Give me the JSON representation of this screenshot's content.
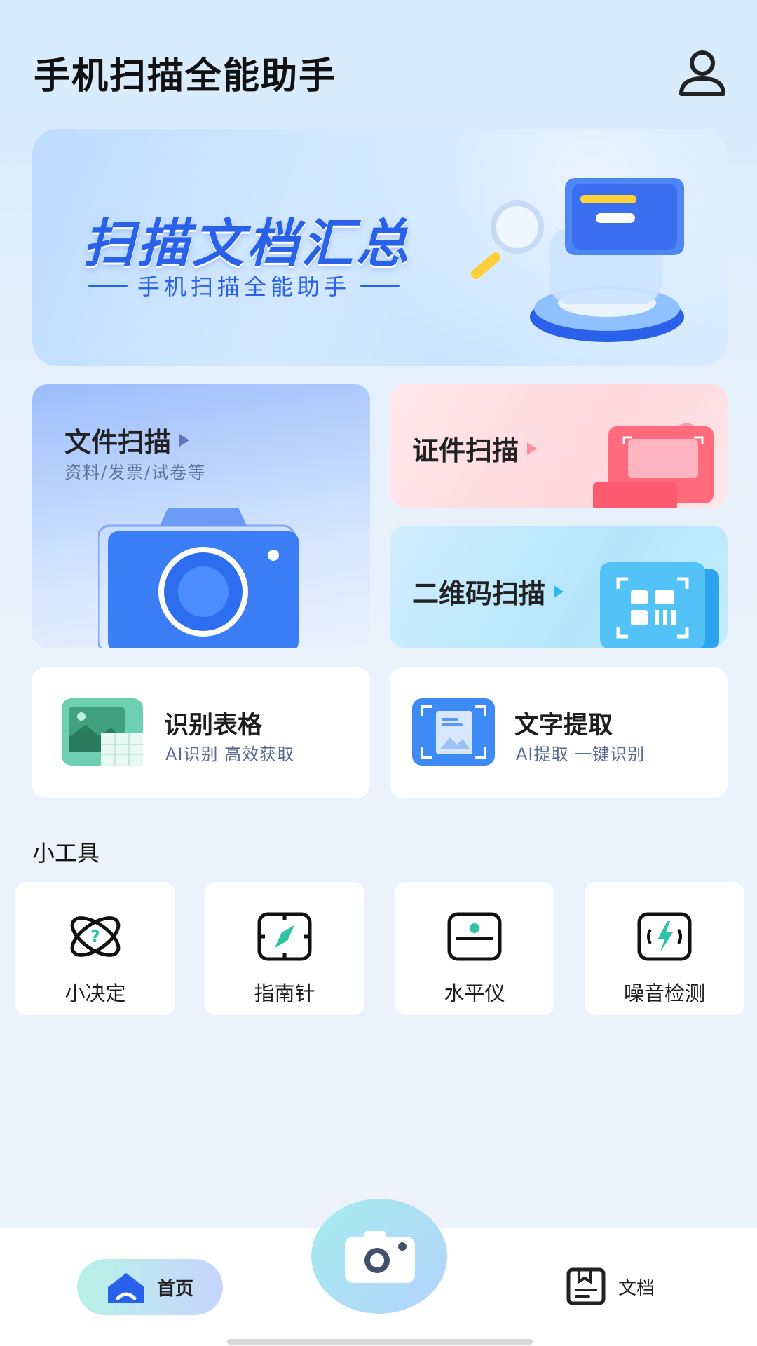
{
  "header": {
    "title": "手机扫描全能助手",
    "profile_icon": "user-icon"
  },
  "banner": {
    "title": "扫描文档汇总",
    "subtitle": "手机扫描全能助手"
  },
  "features": {
    "file_scan": {
      "label": "文件扫描",
      "sub": "资料/发票/试卷等",
      "icon": "camera-icon"
    },
    "id_scan": {
      "label": "证件扫描",
      "icon": "id-card-icon"
    },
    "qr_scan": {
      "label": "二维码扫描",
      "icon": "qr-code-icon"
    }
  },
  "recognition": {
    "table": {
      "title": "识别表格",
      "sub": "AI识别 高效获取",
      "icon": "table-image-icon"
    },
    "text": {
      "title": "文字提取",
      "sub": "AI提取 一键识别",
      "icon": "document-scan-icon"
    }
  },
  "tools": {
    "section_title": "小工具",
    "items": [
      {
        "label": "小决定",
        "icon": "decision-icon"
      },
      {
        "label": "指南针",
        "icon": "compass-icon"
      },
      {
        "label": "水平仪",
        "icon": "level-icon"
      },
      {
        "label": "噪音检测",
        "icon": "noise-icon"
      }
    ]
  },
  "bottom_nav": {
    "home_label": "首页",
    "docs_label": "文档",
    "camera_icon": "camera-icon"
  },
  "colors": {
    "accent_blue": "#2a61ea",
    "teal": "#2fc4a4"
  }
}
